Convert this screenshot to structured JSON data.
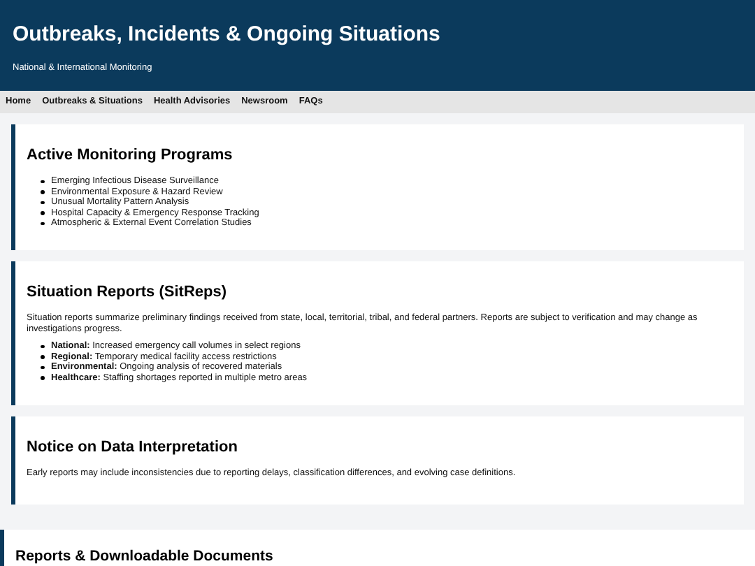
{
  "header": {
    "title": "Outbreaks, Incidents & Ongoing Situations",
    "subtitle": "National & International Monitoring"
  },
  "nav": [
    "Home",
    "Outbreaks & Situations",
    "Health Advisories",
    "Newsroom",
    "FAQs"
  ],
  "sections": [
    {
      "heading": "Active Monitoring Programs",
      "items": [
        "Emerging Infectious Disease Surveillance",
        "Environmental Exposure & Hazard Review",
        "Unusual Mortality Pattern Analysis",
        "Hospital Capacity & Emergency Response Tracking",
        "Atmospheric & External Event Correlation Studies"
      ]
    },
    {
      "heading": "Situation Reports (SitReps)",
      "paragraph": "Situation reports summarize preliminary findings received from state, local, territorial, tribal, and federal partners. Reports are subject to verification and may change as investigations progress.",
      "items": [
        "**National:** Increased emergency call volumes in select regions",
        "**Regional:** Temporary medical facility access restrictions",
        "**Environmental:** Ongoing analysis of recovered materials",
        "**Healthcare:** Staffing shortages reported in multiple metro areas"
      ]
    },
    {
      "heading": "Notice on Data Interpretation",
      "paragraph": "Early reports may include inconsistencies due to reporting delays, classification differences, and evolving case definitions."
    }
  ],
  "reports": {
    "heading": "Reports & Downloadable Documents"
  }
}
